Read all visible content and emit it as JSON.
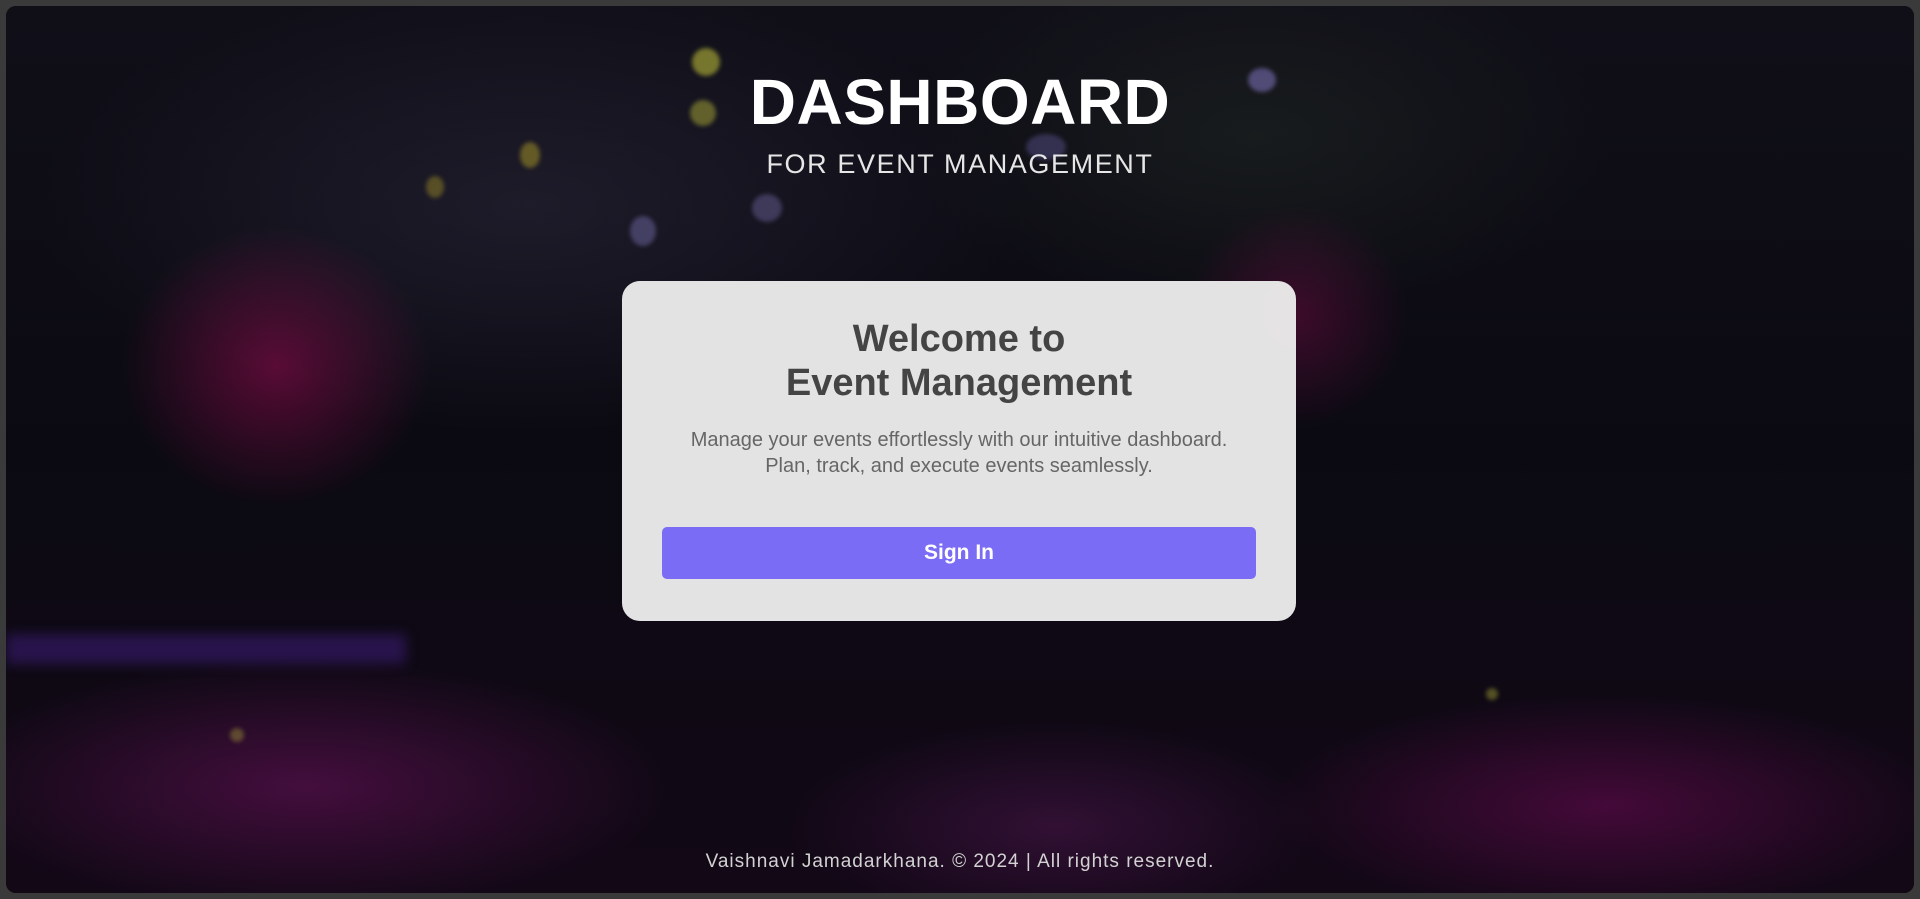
{
  "header": {
    "title": "DASHBOARD",
    "subtitle": "FOR EVENT MANAGEMENT"
  },
  "card": {
    "heading_line1": "Welcome to",
    "heading_line2": "Event Management",
    "description_line1": "Manage your events effortlessly with our intuitive dashboard.",
    "description_line2": "Plan, track, and execute events seamlessly.",
    "signin_label": "Sign In"
  },
  "footer": {
    "text": "Vaishnavi Jamadarkhana. © 2024 | All rights reserved."
  },
  "colors": {
    "accent": "#7b6cf6",
    "card_background": "#ececec",
    "heading_text": "#444444",
    "body_text": "#666666"
  }
}
